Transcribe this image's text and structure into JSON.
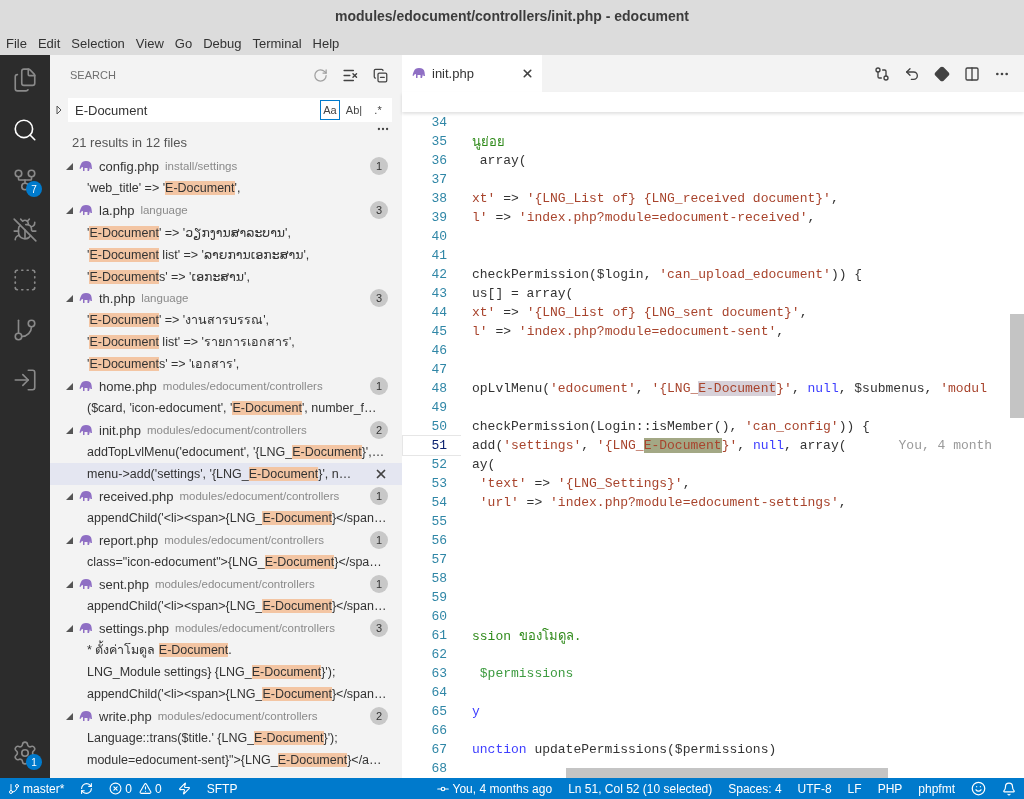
{
  "window": {
    "title": "modules/edocument/controllers/init.php - edocument"
  },
  "menu": [
    "File",
    "Edit",
    "Selection",
    "View",
    "Go",
    "Debug",
    "Terminal",
    "Help"
  ],
  "activity_bar": {
    "items": [
      {
        "kind": "files",
        "selected": false
      },
      {
        "kind": "search",
        "selected": true
      },
      {
        "kind": "source-control",
        "selected": false,
        "badge": "7"
      },
      {
        "kind": "debug",
        "selected": false
      },
      {
        "kind": "extensions",
        "selected": false
      },
      {
        "kind": "git-graph",
        "selected": false
      },
      {
        "kind": "remote",
        "selected": false
      }
    ],
    "settings_badge": "1"
  },
  "sidebar": {
    "title": "SEARCH",
    "search": {
      "value": "E-Document",
      "toggles": [
        {
          "label": "Aa",
          "selected": true
        },
        {
          "label": "Ab|",
          "selected": false
        },
        {
          "label": ".*",
          "selected": false
        }
      ]
    },
    "summary": "21 results in 12 files",
    "results": [
      {
        "file": "config.php",
        "path": "install/settings",
        "count": "1",
        "expanded": true,
        "matches": [
          {
            "before": "'web_title' => '",
            "match": "E-Document",
            "after": "',",
            "selected": false
          }
        ]
      },
      {
        "file": "la.php",
        "path": "language",
        "count": "3",
        "expanded": true,
        "matches": [
          {
            "before": "'",
            "match": "E-Document",
            "after": "' => 'ວຽກງານສາລະບານ',",
            "selected": false
          },
          {
            "before": "'",
            "match": "E-Document",
            "after": " list' => 'ລາຍການເອກະສານ',",
            "selected": false
          },
          {
            "before": "'",
            "match": "E-Document",
            "after": "s' => 'ເອກະສານ',",
            "selected": false
          }
        ]
      },
      {
        "file": "th.php",
        "path": "language",
        "count": "3",
        "expanded": true,
        "matches": [
          {
            "before": "'",
            "match": "E-Document",
            "after": "' => 'งานสารบรรณ',",
            "selected": false
          },
          {
            "before": "'",
            "match": "E-Document",
            "after": " list' => 'รายการเอกสาร',",
            "selected": false
          },
          {
            "before": "'",
            "match": "E-Document",
            "after": "s' => 'เอกสาร',",
            "selected": false
          }
        ]
      },
      {
        "file": "home.php",
        "path": "modules/edocument/controllers",
        "count": "1",
        "expanded": true,
        "matches": [
          {
            "before": "($card, 'icon-edocument', '",
            "match": "E-Document",
            "after": "', number_f…",
            "selected": false
          }
        ]
      },
      {
        "file": "init.php",
        "path": "modules/edocument/controllers",
        "count": "2",
        "expanded": true,
        "matches": [
          {
            "before": "addTopLvlMenu('edocument', '{LNG_",
            "match": "E-Document",
            "after": "}',…",
            "selected": false
          },
          {
            "before": "menu->add('settings', '{LNG_",
            "match": "E-Document",
            "after": "}', n…",
            "selected": true
          }
        ]
      },
      {
        "file": "received.php",
        "path": "modules/edocument/controllers",
        "count": "1",
        "expanded": true,
        "matches": [
          {
            "before": "appendChild('<li><span>{LNG_",
            "match": "E-Document",
            "after": "}</span…",
            "selected": false
          }
        ]
      },
      {
        "file": "report.php",
        "path": "modules/edocument/controllers",
        "count": "1",
        "expanded": true,
        "matches": [
          {
            "before": "class=\"icon-edocument\">{LNG_",
            "match": "E-Document",
            "after": "}</spa…",
            "selected": false
          }
        ]
      },
      {
        "file": "sent.php",
        "path": "modules/edocument/controllers",
        "count": "1",
        "expanded": true,
        "matches": [
          {
            "before": "appendChild('<li><span>{LNG_",
            "match": "E-Document",
            "after": "}</span…",
            "selected": false
          }
        ]
      },
      {
        "file": "settings.php",
        "path": "modules/edocument/controllers",
        "count": "3",
        "expanded": true,
        "matches": [
          {
            "before": "* ตั้งค่าโมดูล ",
            "match": "E-Document",
            "after": ".",
            "selected": false
          },
          {
            "before": "LNG_Module settings} {LNG_",
            "match": "E-Document",
            "after": "}');",
            "selected": false
          },
          {
            "before": "appendChild('<li><span>{LNG_",
            "match": "E-Document",
            "after": "}</span…",
            "selected": false
          }
        ]
      },
      {
        "file": "write.php",
        "path": "modules/edocument/controllers",
        "count": "2",
        "expanded": true,
        "matches": [
          {
            "before": "Language::trans($title.' {LNG_",
            "match": "E-Document",
            "after": "}');",
            "selected": false
          },
          {
            "before": "module=edocument-sent}\">{LNG_",
            "match": "E-Document",
            "after": "}</a…",
            "selected": false
          }
        ]
      }
    ]
  },
  "editor": {
    "tabs": [
      {
        "label": "init.php",
        "selected": true
      }
    ],
    "lines": [
      {
        "number": "34",
        "current": false
      },
      {
        "number": "35",
        "current": false,
        "tokens": [
          {
            "t": "นูย่อย",
            "kind": "comment"
          }
        ]
      },
      {
        "number": "36",
        "current": false,
        "tokens": [
          {
            "t": " array(",
            "kind": "plain"
          }
        ]
      },
      {
        "number": "37",
        "current": false
      },
      {
        "number": "38",
        "current": false,
        "tokens": [
          {
            "t": "xt'",
            "kind": "string"
          },
          {
            "t": " => ",
            "kind": "plain"
          },
          {
            "t": "'{LNG_List of} {LNG_received document}'",
            "kind": "string"
          },
          {
            "t": ",",
            "kind": "plain"
          }
        ]
      },
      {
        "number": "39",
        "current": false,
        "tokens": [
          {
            "t": "l'",
            "kind": "string"
          },
          {
            "t": " => ",
            "kind": "plain"
          },
          {
            "t": "'index.php?module=edocument-received'",
            "kind": "string"
          },
          {
            "t": ",",
            "kind": "plain"
          }
        ]
      },
      {
        "number": "40",
        "current": false
      },
      {
        "number": "41",
        "current": false
      },
      {
        "number": "42",
        "current": false,
        "tokens": [
          {
            "t": "checkPermission($login, ",
            "kind": "plain"
          },
          {
            "t": "'can_upload_edocument'",
            "kind": "string"
          },
          {
            "t": ")) {",
            "kind": "plain"
          }
        ]
      },
      {
        "number": "43",
        "current": false,
        "tokens": [
          {
            "t": "us[] = array(",
            "kind": "plain"
          }
        ]
      },
      {
        "number": "44",
        "current": false,
        "tokens": [
          {
            "t": "xt'",
            "kind": "string"
          },
          {
            "t": " => ",
            "kind": "plain"
          },
          {
            "t": "'{LNG_List of} {LNG_sent document}'",
            "kind": "string"
          },
          {
            "t": ",",
            "kind": "plain"
          }
        ]
      },
      {
        "number": "45",
        "current": false,
        "tokens": [
          {
            "t": "l'",
            "kind": "string"
          },
          {
            "t": " => ",
            "kind": "plain"
          },
          {
            "t": "'index.php?module=edocument-sent'",
            "kind": "string"
          },
          {
            "t": ",",
            "kind": "plain"
          }
        ]
      },
      {
        "number": "46",
        "current": false
      },
      {
        "number": "47",
        "current": false
      },
      {
        "number": "48",
        "current": false,
        "tokens": [
          {
            "t": "opLvlMenu(",
            "kind": "plain"
          },
          {
            "t": "'edocument'",
            "kind": "string"
          },
          {
            "t": ", ",
            "kind": "plain"
          },
          {
            "t": "'{LNG_",
            "kind": "string"
          },
          {
            "t": "E-Document",
            "kind": "match"
          },
          {
            "t": "}'",
            "kind": "string"
          },
          {
            "t": ", ",
            "kind": "plain"
          },
          {
            "t": "null",
            "kind": "keyword"
          },
          {
            "t": ", $submenus, ",
            "kind": "plain"
          },
          {
            "t": "'modul",
            "kind": "string"
          }
        ]
      },
      {
        "number": "49",
        "current": false
      },
      {
        "number": "50",
        "current": false,
        "tokens": [
          {
            "t": "checkPermission(Login::isMember(), ",
            "kind": "plain"
          },
          {
            "t": "'can_config'",
            "kind": "string"
          },
          {
            "t": ")) {",
            "kind": "plain"
          }
        ]
      },
      {
        "number": "51",
        "current": true,
        "tokens": [
          {
            "t": "add(",
            "kind": "plain"
          },
          {
            "t": "'settings'",
            "kind": "string"
          },
          {
            "t": ", ",
            "kind": "plain"
          },
          {
            "t": "'{LNG_",
            "kind": "string"
          },
          {
            "t": "E-Document",
            "kind": "selection"
          },
          {
            "t": "}'",
            "kind": "string"
          },
          {
            "t": ", ",
            "kind": "plain"
          },
          {
            "t": "null",
            "kind": "keyword"
          },
          {
            "t": ", array(",
            "kind": "plain"
          }
        ],
        "blame": "You, 4 month"
      },
      {
        "number": "52",
        "current": false,
        "tokens": [
          {
            "t": "ay(",
            "kind": "plain"
          }
        ]
      },
      {
        "number": "53",
        "current": false,
        "tokens": [
          {
            "t": " 'text'",
            "kind": "string"
          },
          {
            "t": " => ",
            "kind": "plain"
          },
          {
            "t": "'{LNG_Settings}'",
            "kind": "string"
          },
          {
            "t": ",",
            "kind": "plain"
          }
        ]
      },
      {
        "number": "54",
        "current": false,
        "tokens": [
          {
            "t": " 'url'",
            "kind": "string"
          },
          {
            "t": " => ",
            "kind": "plain"
          },
          {
            "t": "'index.php?module=edocument-settings'",
            "kind": "string"
          },
          {
            "t": ",",
            "kind": "plain"
          }
        ]
      },
      {
        "number": "55",
        "current": false
      },
      {
        "number": "56",
        "current": false
      },
      {
        "number": "57",
        "current": false
      },
      {
        "number": "58",
        "current": false
      },
      {
        "number": "59",
        "current": false
      },
      {
        "number": "60",
        "current": false
      },
      {
        "number": "61",
        "current": false,
        "tokens": [
          {
            "t": "ssion ของโมดูล.",
            "kind": "comment"
          }
        ]
      },
      {
        "number": "62",
        "current": false
      },
      {
        "number": "63",
        "current": false,
        "tokens": [
          {
            "t": " $permissions",
            "kind": "variable"
          }
        ]
      },
      {
        "number": "64",
        "current": false
      },
      {
        "number": "65",
        "current": false,
        "tokens": [
          {
            "t": "y",
            "kind": "keyword"
          }
        ]
      },
      {
        "number": "66",
        "current": false
      },
      {
        "number": "67",
        "current": false,
        "tokens": [
          {
            "t": "unction",
            "kind": "keyword"
          },
          {
            "t": " updatePermissions($permissions)",
            "kind": "plain"
          }
        ]
      },
      {
        "number": "68",
        "current": false
      }
    ]
  },
  "status_bar": {
    "left": [
      {
        "kind": "branch",
        "text": "master*"
      },
      {
        "kind": "sync"
      },
      {
        "kind": "problems",
        "errors": "0",
        "warnings": "0"
      },
      {
        "kind": "lightning"
      },
      {
        "kind": "text",
        "text": "SFTP"
      }
    ],
    "right": [
      {
        "kind": "blame",
        "text": "You, 4 months ago"
      },
      {
        "kind": "text",
        "text": "Ln 51, Col 52 (10 selected)"
      },
      {
        "kind": "text",
        "text": "Spaces: 4"
      },
      {
        "kind": "text",
        "text": "UTF-8"
      },
      {
        "kind": "text",
        "text": "LF"
      },
      {
        "kind": "text",
        "text": "PHP"
      },
      {
        "kind": "text",
        "text": "phpfmt"
      },
      {
        "kind": "feedback"
      },
      {
        "kind": "bell"
      }
    ]
  }
}
